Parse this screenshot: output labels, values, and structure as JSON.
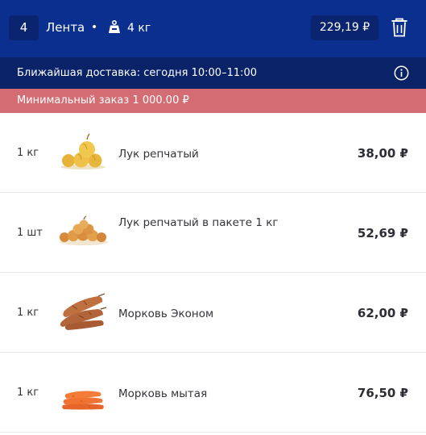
{
  "header": {
    "items_count": "4",
    "store_name": "Лента",
    "separator": "•",
    "weight_icon": "weight-icon",
    "weight": "4 кг",
    "total_price": "229,19 ₽",
    "trash_icon": "trash-icon"
  },
  "delivery": {
    "text": "Ближайшая доставка: сегодня 10:00–11:00",
    "info_icon": "info-icon"
  },
  "min_order": {
    "text": "Минимальный заказ 1 000.00 ₽"
  },
  "items": [
    {
      "qty": "1 кг",
      "name": "Лук репчатый",
      "price": "38,00 ₽",
      "image": "onion-bulbs"
    },
    {
      "qty": "1 шт",
      "name": "Лук репчатый в пакете 1 кг",
      "price": "52,69 ₽",
      "image": "onion-pile"
    },
    {
      "qty": "1 кг",
      "name": "Морковь Эконом",
      "price": "62,00 ₽",
      "image": "dirty-carrots"
    },
    {
      "qty": "1 кг",
      "name": "Морковь мытая",
      "price": "76,50 ₽",
      "image": "washed-carrots"
    }
  ],
  "colors": {
    "header_bg": "#0b2f8f",
    "delivery_bg": "#0a2268",
    "min_order_bg": "#d46c73"
  }
}
